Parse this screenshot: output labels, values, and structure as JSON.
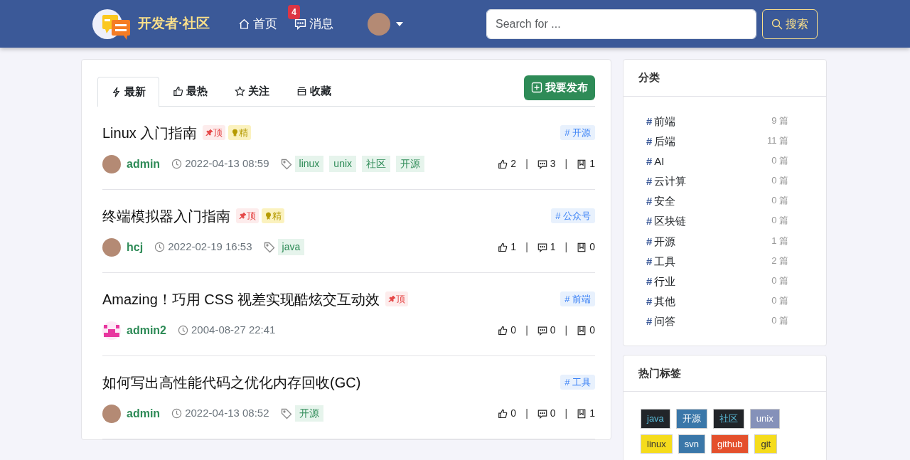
{
  "navbar": {
    "brand": "开发者·社区",
    "nav_items": [
      {
        "kind": "home",
        "label": "首页"
      },
      {
        "kind": "messages",
        "label": "消息",
        "badge": "4"
      }
    ],
    "search": {
      "placeholder": "Search for ..."
    },
    "search_button": "搜索"
  },
  "tabs": [
    {
      "label": "最新",
      "selected": true
    },
    {
      "label": "最热",
      "selected": false
    },
    {
      "label": "关注",
      "selected": false
    },
    {
      "label": "收藏",
      "selected": false
    }
  ],
  "stat_separator": "|",
  "publish_button": "我要发布",
  "posts": [
    {
      "title": "Linux 入门指南",
      "flags": [
        {
          "kind": "top",
          "label": "顶"
        },
        {
          "kind": "featured",
          "label": "精"
        }
      ],
      "category": "# 开源",
      "kind": "photo",
      "author": "admin",
      "date": "2022-04-13 08:59",
      "tags": [
        "linux",
        "unix",
        "社区",
        "开源"
      ],
      "likes": "2",
      "comments": "3",
      "bookmarks": "1"
    },
    {
      "title": "终端模拟器入门指南",
      "flags": [
        {
          "kind": "top",
          "label": "顶"
        },
        {
          "kind": "featured",
          "label": "精"
        }
      ],
      "category": "# 公众号",
      "kind": "photo",
      "author": "hcj",
      "date": "2022-02-19 16:53",
      "tags": [
        "java"
      ],
      "likes": "1",
      "comments": "1",
      "bookmarks": "0"
    },
    {
      "title": "Amazing！巧用 CSS 视差实现酷炫交互动效",
      "flags": [
        {
          "kind": "top",
          "label": "顶"
        }
      ],
      "category": "# 前端",
      "kind": "identicon",
      "author": "admin2",
      "date": "2004-08-27 22:41",
      "likes": "0",
      "comments": "0",
      "bookmarks": "0"
    },
    {
      "title": "如何写出高性能代码之优化内存回收(GC)",
      "category": "# 工具",
      "kind": "photo",
      "author": "admin",
      "date": "2022-04-13 08:52",
      "tags": [
        "开源"
      ],
      "likes": "0",
      "comments": "0",
      "bookmarks": "1"
    }
  ],
  "categories": {
    "title": "分类",
    "items": [
      {
        "symbol": "#",
        "name": "前端",
        "count": "9 篇"
      },
      {
        "symbol": "#",
        "name": "后端",
        "count": "11 篇"
      },
      {
        "symbol": "#",
        "name": "AI",
        "count": "0 篇"
      },
      {
        "symbol": "#",
        "name": "云计算",
        "count": "0 篇"
      },
      {
        "symbol": "#",
        "name": "安全",
        "count": "0 篇"
      },
      {
        "symbol": "#",
        "name": "区块链",
        "count": "0 篇"
      },
      {
        "symbol": "#",
        "name": "开源",
        "count": "1 篇"
      },
      {
        "symbol": "#",
        "name": "工具",
        "count": "2 篇"
      },
      {
        "symbol": "#",
        "name": "行业",
        "count": "0 篇"
      },
      {
        "symbol": "#",
        "name": "其他",
        "count": "0 篇"
      },
      {
        "symbol": "#",
        "name": "问答",
        "count": "0 篇"
      }
    ]
  },
  "hot_tags": {
    "title": "热门标签",
    "items": [
      {
        "label": "java",
        "color": "#212529"
      },
      {
        "label": "开源",
        "color": "#3a77a9"
      },
      {
        "label": "社区",
        "color": "#212529"
      },
      {
        "label": "unix",
        "color": "#8591b9"
      },
      {
        "label": "linux",
        "color": "#f5dc1c"
      },
      {
        "label": "svn",
        "color": "#3a77a9"
      },
      {
        "label": "github",
        "color": "#e4502c"
      },
      {
        "label": "git",
        "color": "#f5dc1c"
      }
    ]
  }
}
